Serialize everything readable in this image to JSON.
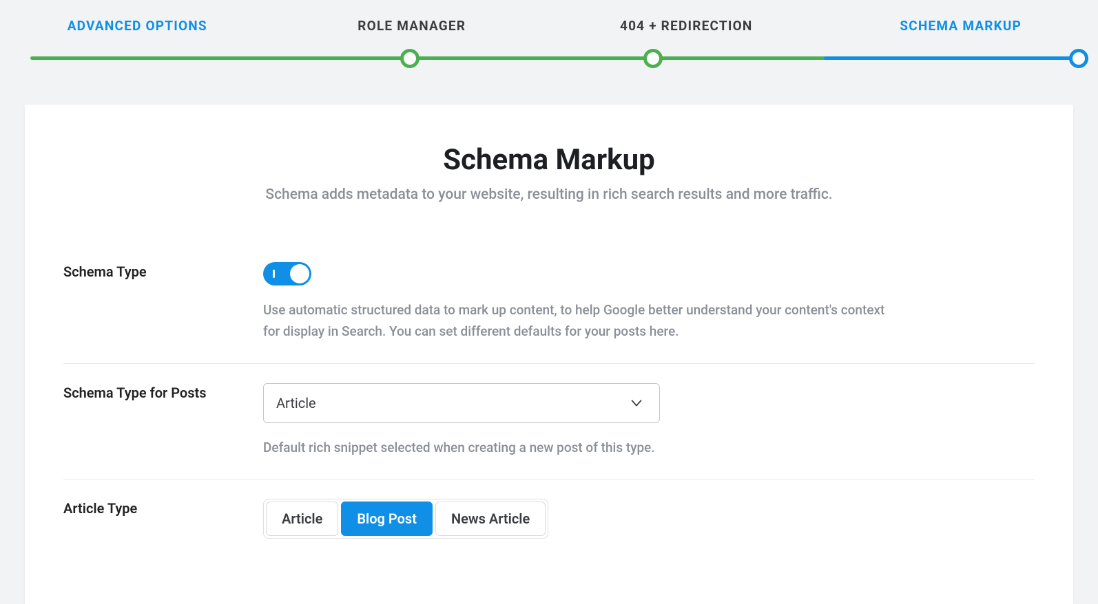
{
  "stepper": {
    "steps": [
      {
        "label": "ADVANCED OPTIONS"
      },
      {
        "label": "ROLE MANAGER"
      },
      {
        "label": "404 + REDIRECTION"
      },
      {
        "label": "SCHEMA MARKUP"
      }
    ]
  },
  "page": {
    "title": "Schema Markup",
    "subtitle": "Schema adds metadata to your website, resulting in rich search results and more traffic."
  },
  "schema_type": {
    "label": "Schema Type",
    "enabled": true,
    "desc": "Use automatic structured data to mark up content, to help Google better understand your content's context for display in Search. You can set different defaults for your posts here."
  },
  "schema_type_posts": {
    "label": "Schema Type for Posts",
    "value": "Article",
    "desc": "Default rich snippet selected when creating a new post of this type."
  },
  "article_type": {
    "label": "Article Type",
    "options": [
      "Article",
      "Blog Post",
      "News Article"
    ],
    "active": "Blog Post"
  }
}
